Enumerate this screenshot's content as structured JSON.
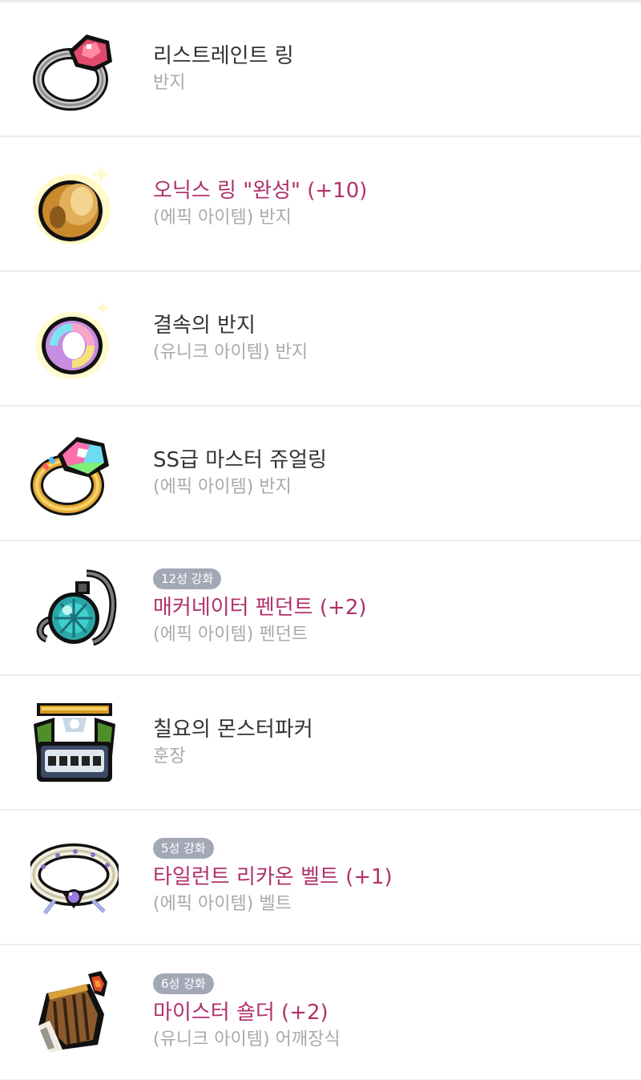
{
  "items": [
    {
      "icon": "restraint-ring-icon",
      "badge": "",
      "name": "리스트레인트 링",
      "type": "반지",
      "highlight": false
    },
    {
      "icon": "oniks-ring-icon",
      "badge": "",
      "name": "오닉스 링 \"완성\" (+10)",
      "type": "(에픽 아이템) 반지",
      "highlight": true
    },
    {
      "icon": "ring-of-ties-icon",
      "badge": "",
      "name": "결속의 반지",
      "type": "(유니크 아이템) 반지",
      "highlight": false
    },
    {
      "icon": "ss-master-jewel-ring-icon",
      "badge": "",
      "name": "SS급 마스터 쥬얼링",
      "type": "(에픽 아이템) 반지",
      "highlight": false
    },
    {
      "icon": "macanator-pendant-icon",
      "badge": "12성 강화",
      "name": "매커네이터 펜던트 (+2)",
      "type": "(에픽 아이템) 펜던트",
      "highlight": true
    },
    {
      "icon": "monster-park-medal-icon",
      "badge": "",
      "name": "칠요의 몬스터파커",
      "type": "훈장",
      "highlight": false
    },
    {
      "icon": "tyrant-lycaon-belt-icon",
      "badge": "5성 강화",
      "name": "타일런트 리카온 벨트 (+1)",
      "type": "(에픽 아이템) 벨트",
      "highlight": true
    },
    {
      "icon": "meister-shoulder-icon",
      "badge": "6성 강화",
      "name": "마이스터 숄더 (+2)",
      "type": "(유니크 아이템) 어깨장식",
      "highlight": true
    }
  ],
  "colors": {
    "epic_name": "#b0316b",
    "normal_name": "#333333",
    "type_text": "#a9a9a9",
    "badge_bg": "#a3a8b6",
    "divider": "#ececec"
  }
}
